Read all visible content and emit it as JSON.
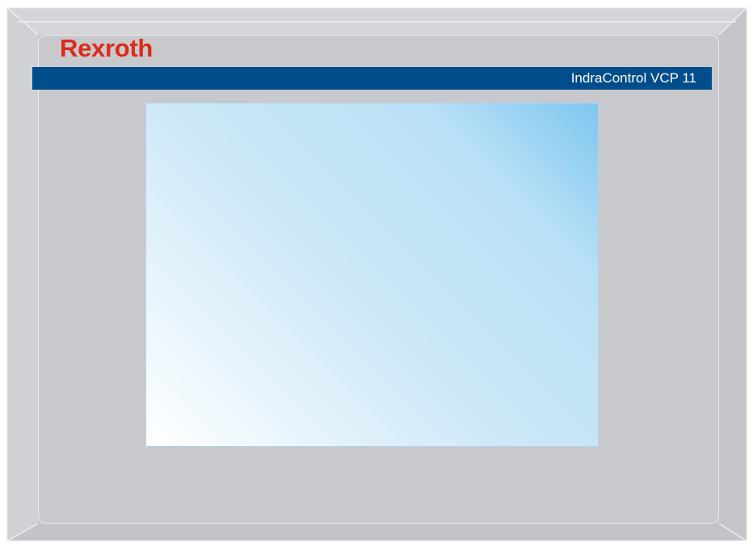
{
  "brand": {
    "name": "Rexroth",
    "color": "#dd2a1b"
  },
  "header": {
    "model": "IndraControl VCP 11",
    "band_color": "#004d8c"
  },
  "screen": {
    "state": "blank"
  }
}
